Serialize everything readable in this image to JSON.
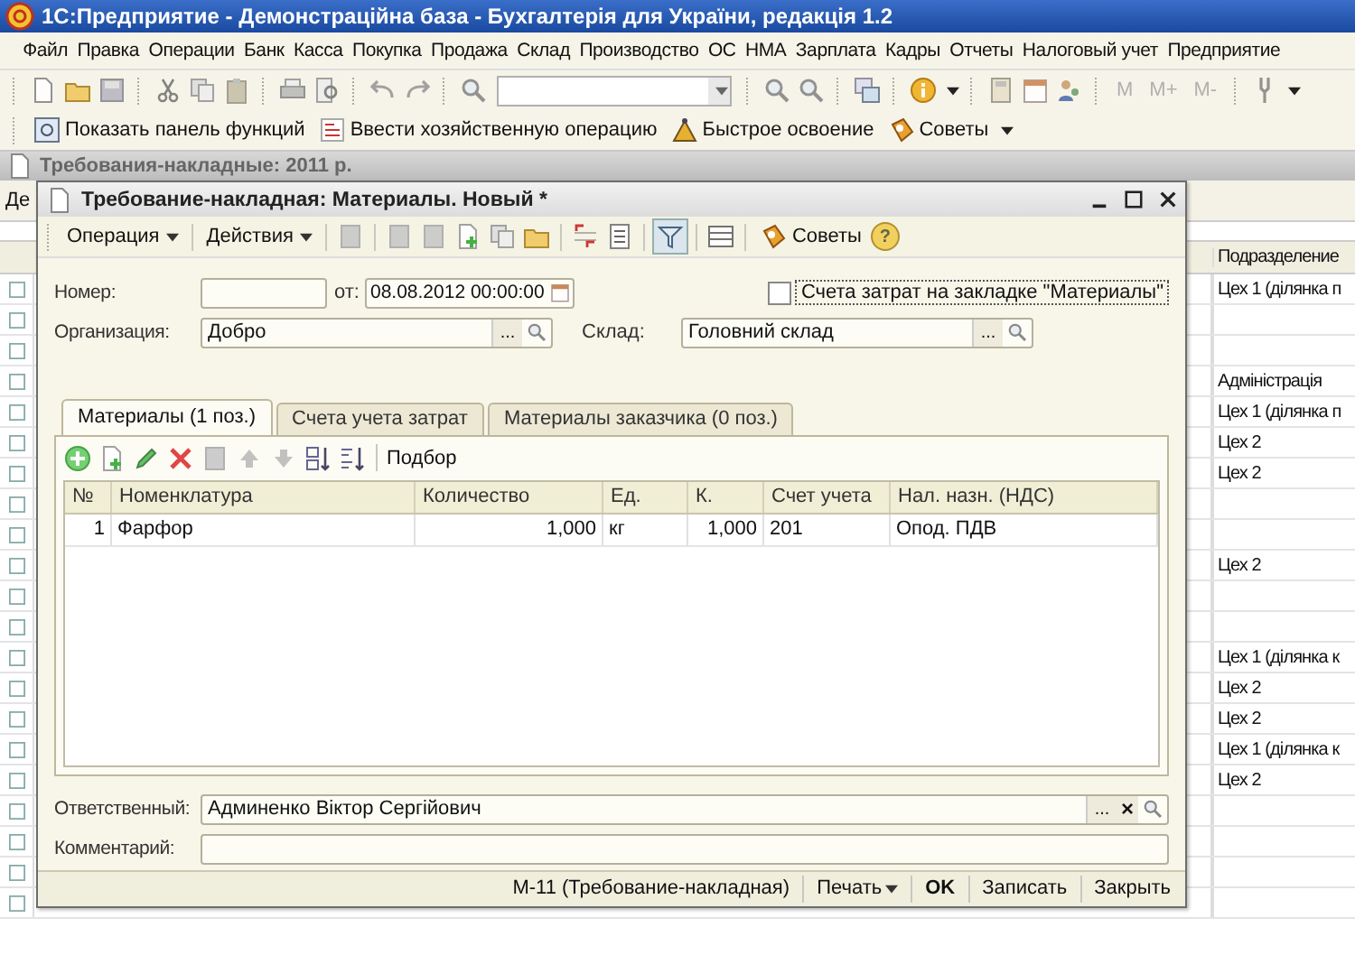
{
  "window": {
    "title": "1С:Предприятие - Демонстраційна база - Бухгалтерія для України, редакція 1.2"
  },
  "menu": [
    {
      "label": "Файл"
    },
    {
      "label": "Правка"
    },
    {
      "label": "Операции"
    },
    {
      "label": "Банк"
    },
    {
      "label": "Касса"
    },
    {
      "label": "Покупка"
    },
    {
      "label": "Продажа"
    },
    {
      "label": "Склад"
    },
    {
      "label": "Производство"
    },
    {
      "label": "ОС"
    },
    {
      "label": "НМА"
    },
    {
      "label": "Зарплата"
    },
    {
      "label": "Кадры"
    },
    {
      "label": "Отчеты"
    },
    {
      "label": "Налоговый учет"
    },
    {
      "label": "Предприятие"
    }
  ],
  "toolbar": {
    "memory_buttons": [
      {
        "label": "M",
        "disabled": true
      },
      {
        "label": "M+",
        "disabled": true
      },
      {
        "label": "M-",
        "disabled": true
      }
    ]
  },
  "function_bar": [
    {
      "label": "Показать панель функций"
    },
    {
      "label": "Ввести хозяйственную операцию"
    },
    {
      "label": "Быстрое освоение"
    },
    {
      "label": "Советы"
    }
  ],
  "list_window": {
    "title": "Требования-накладные: 2011 р.",
    "toolbar_label": "Де",
    "column_header": "Подразделение",
    "rows": [
      {
        "department": "Цех 1 (ділянка п"
      },
      {},
      {},
      {
        "department": "Адміністрація"
      },
      {
        "department": "Цех 1 (ділянка п"
      },
      {
        "department": "Цех 2"
      },
      {
        "department": "Цех 2"
      },
      {},
      {},
      {
        "department": "Цех 2"
      },
      {},
      {},
      {
        "department": "Цех 1 (ділянка к"
      },
      {
        "department": "Цех 2"
      },
      {
        "department": "Цех 2"
      },
      {
        "department": "Цех 1 (ділянка к"
      },
      {
        "department": "Цех 2"
      },
      {},
      {},
      {},
      {}
    ]
  },
  "dialog": {
    "title": "Требование-накладная: Материалы. Новый *",
    "toolbar": {
      "operation": "Операция",
      "actions": "Действия",
      "tips": "Советы",
      "help": "?"
    },
    "number": {
      "label": "Номер:"
    },
    "date": {
      "label": "от:",
      "value": "08.08.2012 00:00:00"
    },
    "cost_accounts_checkbox": {
      "label": "Счета затрат на закладке \"Материалы\"",
      "checked": false
    },
    "organization": {
      "label": "Организация:",
      "value": "Добро",
      "choose": "..."
    },
    "warehouse": {
      "label": "Склад:",
      "value": "Головний склад",
      "choose": "..."
    },
    "tabs": [
      {
        "label": "Материалы (1 поз.)",
        "selected": true
      },
      {
        "label": "Счета учета затрат",
        "selected": false
      },
      {
        "label": "Материалы заказчика (0 поз.)",
        "selected": false
      }
    ],
    "tab_toolbar": {
      "pick": "Подбор"
    },
    "table": {
      "columns": [
        "№",
        "Номенклатура",
        "Количество",
        "Ед.",
        "К.",
        "Счет учета",
        "Нал. назн. (НДС)"
      ],
      "rows": [
        [
          "1",
          "Фарфор",
          "1,000",
          "кг",
          "1,000",
          "201",
          "Опод. ПДВ"
        ]
      ]
    },
    "responsible": {
      "label": "Ответственный:",
      "value": "Админенко Віктор Сергійович",
      "choose": "...",
      "clear": "×"
    },
    "comment": {
      "label": "Комментарий:"
    },
    "footer": {
      "print_form": "М-11 (Требование-накладная)",
      "print": "Печать",
      "ok": "OK",
      "save": "Записать",
      "close": "Закрыть"
    }
  }
}
